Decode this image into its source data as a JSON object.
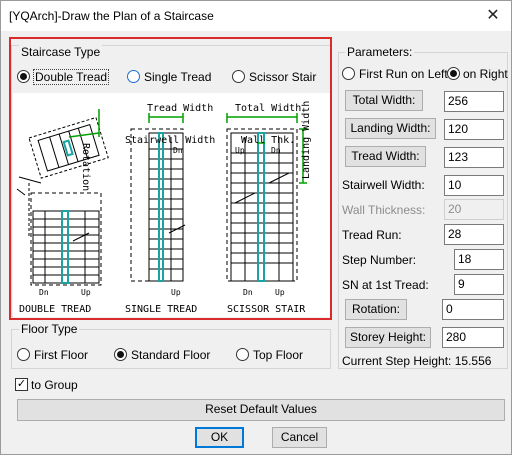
{
  "window": {
    "title": "[YQArch]-Draw the Plan of a Staircase",
    "close_glyph": "✕"
  },
  "staircase_type": {
    "title": "Staircase Type",
    "options": [
      "Double Tread",
      "Single Tread",
      "Scissor Stair"
    ],
    "selected": "Double Tread"
  },
  "diagram": {
    "rotation_label": "Rotation",
    "tread_width": "Tread Width",
    "stairwell_width": "Stairwell Width",
    "total_width": "Total Width",
    "wall_thk": "Wall Thk.",
    "landing_width": "Landing Width",
    "dn": "Dn",
    "up": "Up",
    "captions": [
      "DOUBLE TREAD",
      "SINGLE TREAD",
      "SCISSOR STAIR"
    ]
  },
  "floor_type": {
    "title": "Floor Type",
    "options": [
      "First Floor",
      "Standard Floor",
      "Top Floor"
    ],
    "selected": "Standard Floor"
  },
  "to_group": {
    "label": "to Group",
    "checked": true,
    "check_glyph": "✓"
  },
  "parameters": {
    "title": "Parameters:",
    "first_run": {
      "options": [
        "First Run on Left",
        "on Right"
      ],
      "selected": "on Right"
    },
    "total_width": {
      "label": "Total Width:",
      "value": "256"
    },
    "landing_width": {
      "label": "Landing Width:",
      "value": "120"
    },
    "tread_width": {
      "label": "Tread Width:",
      "value": "123"
    },
    "stairwell_width": {
      "label": "Stairwell Width:",
      "value": "10"
    },
    "wall_thickness": {
      "label": "Wall Thickness:",
      "value": "20"
    },
    "tread_run": {
      "label": "Tread Run:",
      "value": "28"
    },
    "step_number": {
      "label": "Step Number:",
      "value": "18"
    },
    "sn_first_tread": {
      "label": "SN at 1st Tread:",
      "value": "9"
    },
    "rotation": {
      "label": "Rotation:",
      "value": "0"
    },
    "storey_height": {
      "label": "Storey Height:",
      "value": "280"
    },
    "current_step_height": "Current Step Height: 15.556"
  },
  "buttons": {
    "reset": "Reset Default Values",
    "ok": "OK",
    "cancel": "Cancel"
  },
  "colors": {
    "highlight_red": "#d92b2b",
    "diagram_green": "#00a000",
    "diagram_cyan": "#1aa3a3"
  }
}
